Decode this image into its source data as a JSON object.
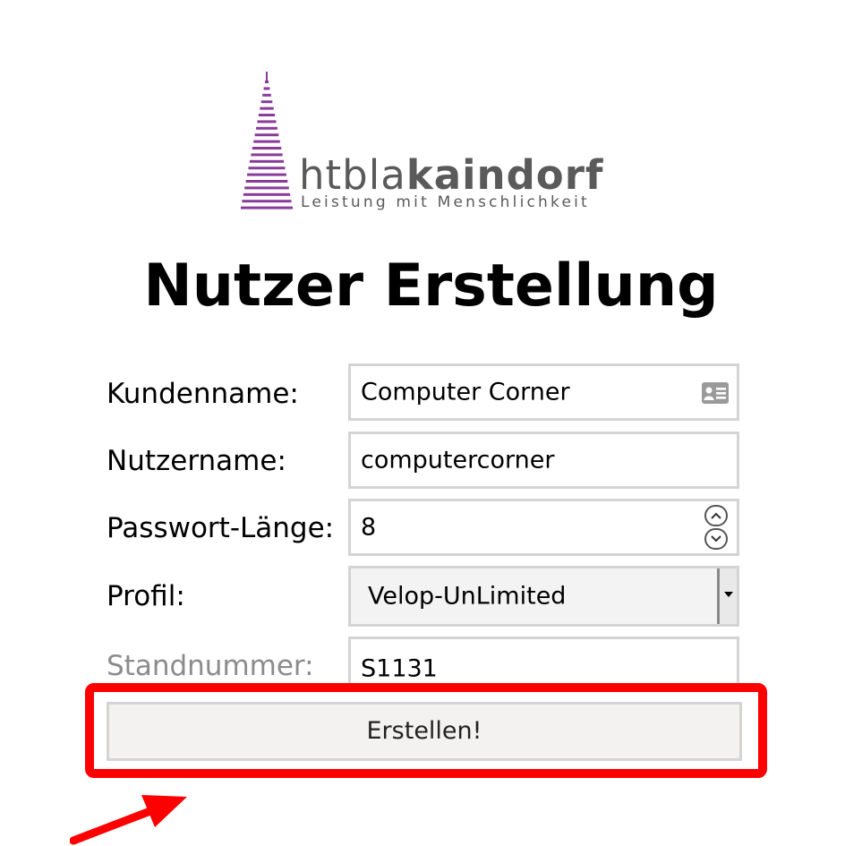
{
  "logo": {
    "word_light": "htbla",
    "word_bold": "kaindorf",
    "tagline": "Leistung mit Menschlichkeit",
    "brand_color": "#8a3b9a",
    "text_color": "#5a5a5a"
  },
  "page": {
    "title": "Nutzer Erstellung"
  },
  "form": {
    "customer_name": {
      "label": "Kundenname:",
      "value": "Computer Corner",
      "icon": "contact-card-icon"
    },
    "username": {
      "label": "Nutzername:",
      "value": "computercorner"
    },
    "password_length": {
      "label": "Passwort-Länge:",
      "value": "8"
    },
    "profile": {
      "label": "Profil:",
      "selected": "Velop-UnLimited"
    },
    "stand_number": {
      "label": "Standnummer:",
      "value": "S1131"
    },
    "submit_label": "Erstellen!"
  },
  "annotation": {
    "highlight_color": "#ff0000"
  }
}
